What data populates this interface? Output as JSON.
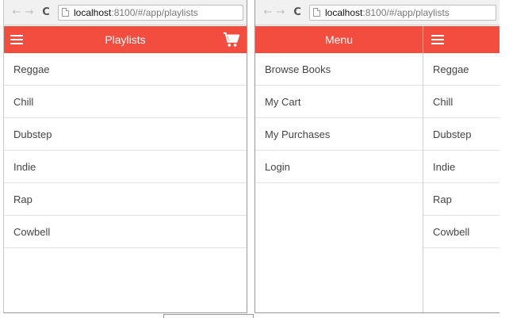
{
  "left_window": {
    "nav": {
      "back": "←",
      "forward": "→",
      "reload": "C"
    },
    "url": {
      "host": "localhost",
      "rest": ":8100/#/app/playlists"
    },
    "header": {
      "title": "Playlists"
    },
    "playlists": [
      "Reggae",
      "Chill",
      "Dubstep",
      "Indie",
      "Rap",
      "Cowbell"
    ]
  },
  "right_window": {
    "nav": {
      "back": "←",
      "forward": "→",
      "reload": "C"
    },
    "url": {
      "host": "localhost",
      "rest": ":8100/#/app/playlists"
    },
    "menu": {
      "title": "Menu",
      "items": [
        "Browse Books",
        "My Cart",
        "My Purchases",
        "Login"
      ]
    },
    "playlists": [
      "Reggae",
      "Chill",
      "Dubstep",
      "Indie",
      "Rap",
      "Cowbell"
    ]
  },
  "colors": {
    "header_bar": "#f24d3f",
    "header_text": "#ffffff"
  },
  "icons": {
    "menu": "hamburger-icon",
    "cart": "cart-icon",
    "page": "page-icon"
  }
}
